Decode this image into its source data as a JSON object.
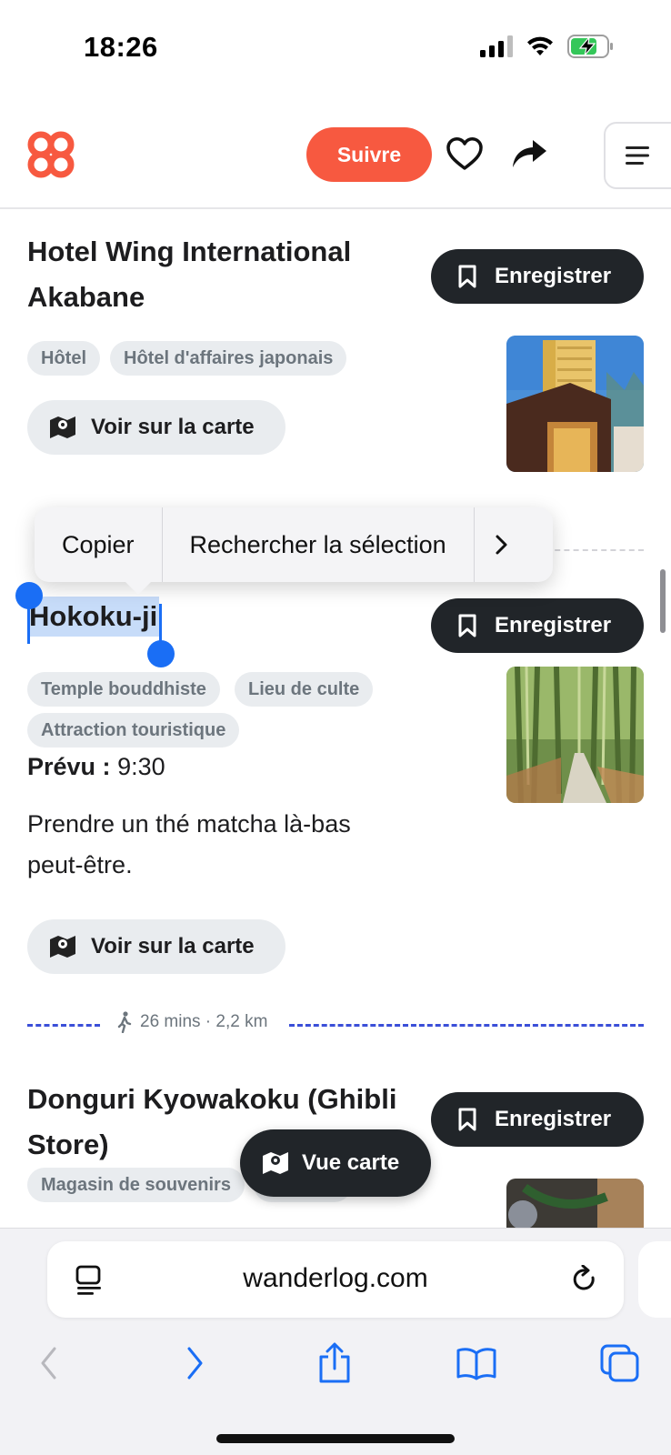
{
  "status_bar": {
    "time": "18:26"
  },
  "header": {
    "follow_label": "Suivre"
  },
  "places": [
    {
      "title": "Hotel Wing International Akabane",
      "save_label": "Enregistrer",
      "tags": [
        "Hôtel",
        "Hôtel d'affaires japonais"
      ],
      "map_label": "Voir sur la carte"
    },
    {
      "title": "Hokoku-ji",
      "save_label": "Enregistrer",
      "tags": [
        "Temple bouddhiste",
        "Lieu de culte",
        "Attraction touristique"
      ],
      "planned_label": "Prévu :",
      "planned_time": "9:30",
      "note": "Prendre un thé matcha là-bas peut-être.",
      "map_label": "Voir sur la carte"
    },
    {
      "title": "Donguri Kyowakoku (Ghibli Store)",
      "save_label": "Enregistrer",
      "tags": [
        "Magasin de souvenirs",
        "Épicerie"
      ]
    }
  ],
  "route": {
    "label": "26 mins · 2,2 km"
  },
  "context_menu": {
    "copy": "Copier",
    "search": "Rechercher la sélection"
  },
  "map_view_label": "Vue carte",
  "browser": {
    "url": "wanderlog.com"
  },
  "colors": {
    "accent": "#f75940",
    "dark_button": "#212529",
    "route": "#3b4fd8",
    "selection": "#1a6ef5"
  }
}
